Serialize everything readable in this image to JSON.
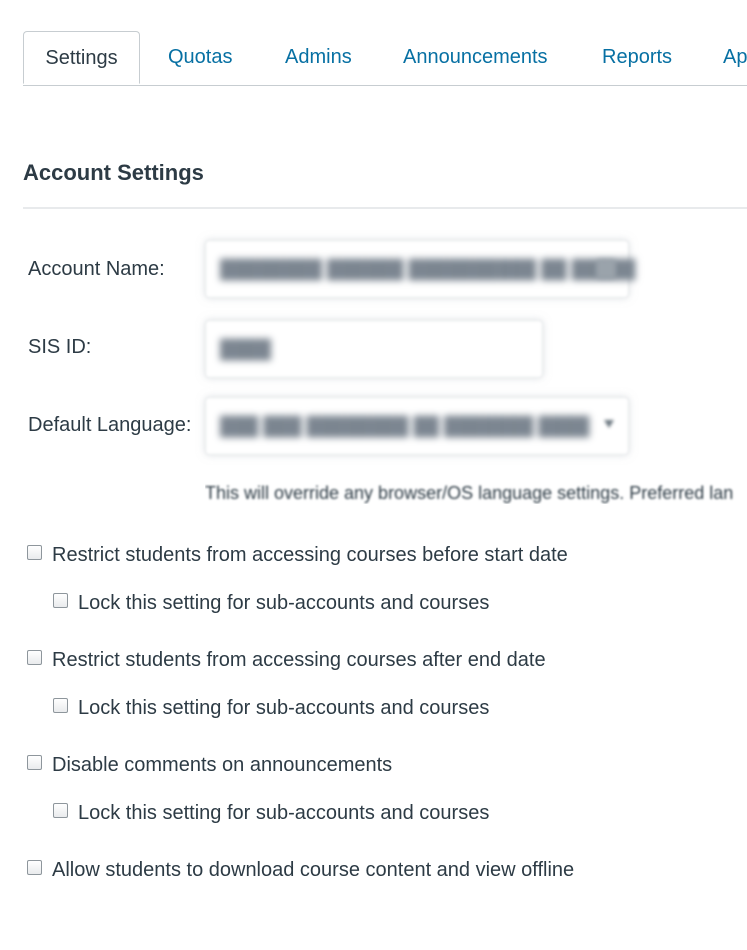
{
  "tabs": [
    {
      "label": "Settings",
      "active": true
    },
    {
      "label": "Quotas"
    },
    {
      "label": "Admins"
    },
    {
      "label": "Announcements"
    },
    {
      "label": "Reports"
    },
    {
      "label": "Ap"
    }
  ],
  "section": {
    "title": "Account Settings"
  },
  "form": {
    "account_name_label": "Account Name:",
    "sis_id_label": "SIS ID:",
    "default_language_label": "Default Language:",
    "language_help": "This will override any browser/OS language settings. Preferred lan"
  },
  "checkboxes": [
    {
      "label": "Restrict students from accessing courses before start date",
      "checked": false
    },
    {
      "label": "Lock this setting for sub-accounts and courses",
      "checked": false
    },
    {
      "label": "Restrict students from accessing courses after end date",
      "checked": false
    },
    {
      "label": "Lock this setting for sub-accounts and courses",
      "checked": false
    },
    {
      "label": "Disable comments on announcements",
      "checked": false
    },
    {
      "label": "Lock this setting for sub-accounts and courses",
      "checked": false
    },
    {
      "label": "Allow students to download course content and view offline",
      "checked": false
    }
  ],
  "colors": {
    "link": "#0770a3",
    "text": "#2d3b45",
    "border": "#c7cdd1"
  }
}
